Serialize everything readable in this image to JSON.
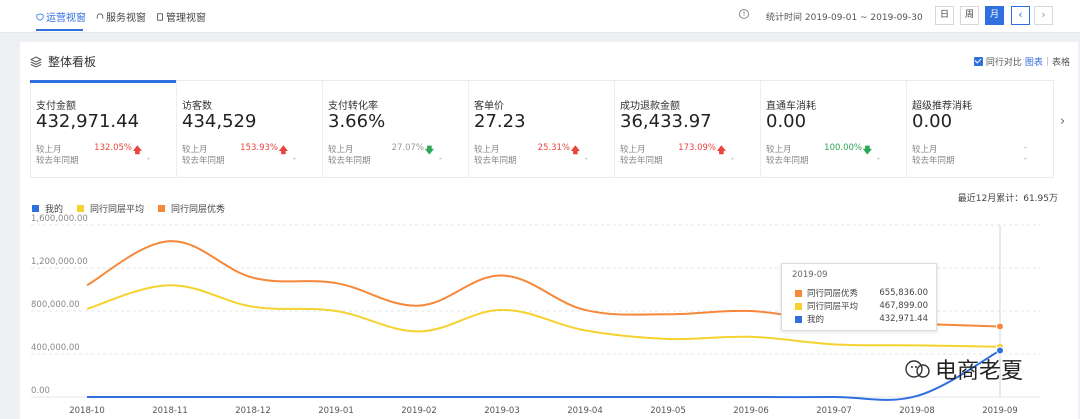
{
  "topbar": {
    "tabs": [
      {
        "label": "运营视窗",
        "icon": "shield-icon",
        "active": true
      },
      {
        "label": "服务视窗",
        "icon": "headset-icon",
        "active": false
      },
      {
        "label": "管理视窗",
        "icon": "document-icon",
        "active": false
      }
    ],
    "info_icon": "info-icon",
    "stat_range": "统计时间 2019-09-01 ~ 2019-09-30",
    "periods": [
      {
        "label": "日",
        "active": false
      },
      {
        "label": "周",
        "active": false
      },
      {
        "label": "月",
        "active": true
      }
    ],
    "prev_label": "‹",
    "next_label": "›"
  },
  "panel": {
    "title": "整体看板",
    "title_icon": "layers-icon",
    "peer_compare": "同行对比",
    "view_chart": "图表",
    "separator": "|",
    "view_table": "表格"
  },
  "metrics": [
    {
      "label": "支付金额",
      "value": "432,971.44",
      "mom_label": "较上月",
      "mom_pct": "132.05%",
      "trend": "up",
      "yoy_label": "较去年同期",
      "yoy": "-",
      "active": true
    },
    {
      "label": "访客数",
      "value": "434,529",
      "mom_label": "较上月",
      "mom_pct": "153.93%",
      "trend": "up",
      "yoy_label": "较去年同期",
      "yoy": "-",
      "active": false
    },
    {
      "label": "支付转化率",
      "value": "3.66%",
      "mom_label": "较上月",
      "mom_pct": "27.07%",
      "trend": "down",
      "yoy_label": "较去年同期",
      "yoy": "-",
      "active": false
    },
    {
      "label": "客单价",
      "value": "27.23",
      "mom_label": "较上月",
      "mom_pct": "25.31%",
      "trend": "up",
      "yoy_label": "较去年同期",
      "yoy": "-",
      "active": false
    },
    {
      "label": "成功退款金额",
      "value": "36,433.97",
      "mom_label": "较上月",
      "mom_pct": "173.09%",
      "trend": "up",
      "yoy_label": "较去年同期",
      "yoy": "-",
      "active": false
    },
    {
      "label": "直通车消耗",
      "value": "0.00",
      "mom_label": "较上月",
      "mom_pct": "100.00%",
      "trend": "down-green",
      "yoy_label": "较去年同期",
      "yoy": "-",
      "active": false
    },
    {
      "label": "超级推荐消耗",
      "value": "0.00",
      "mom_label": "较上月",
      "mom_pct": "-",
      "trend": "none",
      "yoy_label": "较去年同期",
      "yoy": "-",
      "active": false
    }
  ],
  "metrics_next": "›",
  "cumulative": "最近12月累计：61.95万",
  "chart_data": {
    "type": "line",
    "categories": [
      "2018-10",
      "2018-11",
      "2018-12",
      "2019-01",
      "2019-02",
      "2019-03",
      "2019-04",
      "2019-05",
      "2019-06",
      "2019-07",
      "2019-08",
      "2019-09"
    ],
    "y_tick_labels": [
      "1,600,000.00",
      "1,200,000.00",
      "800,000.00",
      "400,000.00",
      "0.00"
    ],
    "ylim": [
      0,
      1600000
    ],
    "grid": true,
    "legend_position": "top-left",
    "series": [
      {
        "name": "我的",
        "color": "#2f6fde",
        "values": [
          0,
          0,
          0,
          0,
          0,
          0,
          0,
          0,
          0,
          0,
          10000,
          432971.44
        ]
      },
      {
        "name": "同行同层平均",
        "color": "#f5d22f",
        "values": [
          820000,
          1040000,
          840000,
          800000,
          610000,
          810000,
          620000,
          540000,
          560000,
          490000,
          480000,
          467899
        ]
      },
      {
        "name": "同行同层优秀",
        "color": "#f5883a",
        "values": [
          1040000,
          1450000,
          1110000,
          1060000,
          850000,
          1130000,
          810000,
          770000,
          800000,
          700000,
          680000,
          655836
        ]
      }
    ]
  },
  "tooltip": {
    "title": "2019-09",
    "rows": [
      {
        "name": "同行同层优秀",
        "value": "655,836.00",
        "color": "#f5883a"
      },
      {
        "name": "同行同层平均",
        "value": "467,899.00",
        "color": "#f5d22f"
      },
      {
        "name": "我的",
        "value": "432,971.44",
        "color": "#2f6fde"
      }
    ]
  },
  "watermark": {
    "text": "电商老夏"
  }
}
